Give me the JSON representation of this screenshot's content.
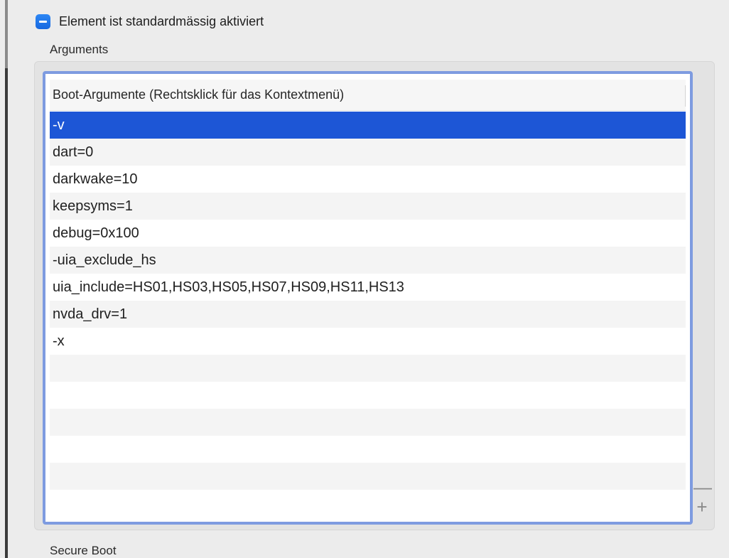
{
  "checkbox": {
    "label": "Element ist standardmässig aktiviert",
    "state": "mixed"
  },
  "arguments_section": {
    "title": "Arguments",
    "table": {
      "header": "Boot-Argumente (Rechtsklick für das Kontextmenü)",
      "rows": [
        "-v",
        "dart=0",
        "darkwake=10",
        "keepsyms=1",
        "debug=0x100",
        "-uia_exclude_hs",
        "uia_include=HS01,HS03,HS05,HS07,HS09,HS11,HS13",
        "nvda_drv=1",
        "-x",
        "",
        "",
        "",
        "",
        "",
        ""
      ],
      "selected_index": 0
    },
    "remove_label": "—",
    "add_label": "+"
  },
  "secure_boot_section": {
    "title": "Secure Boot"
  },
  "colors": {
    "accent": "#1d56d6",
    "checkbox": "#1a73e8",
    "focus_ring": "#7e9be0",
    "background": "#ececec"
  }
}
